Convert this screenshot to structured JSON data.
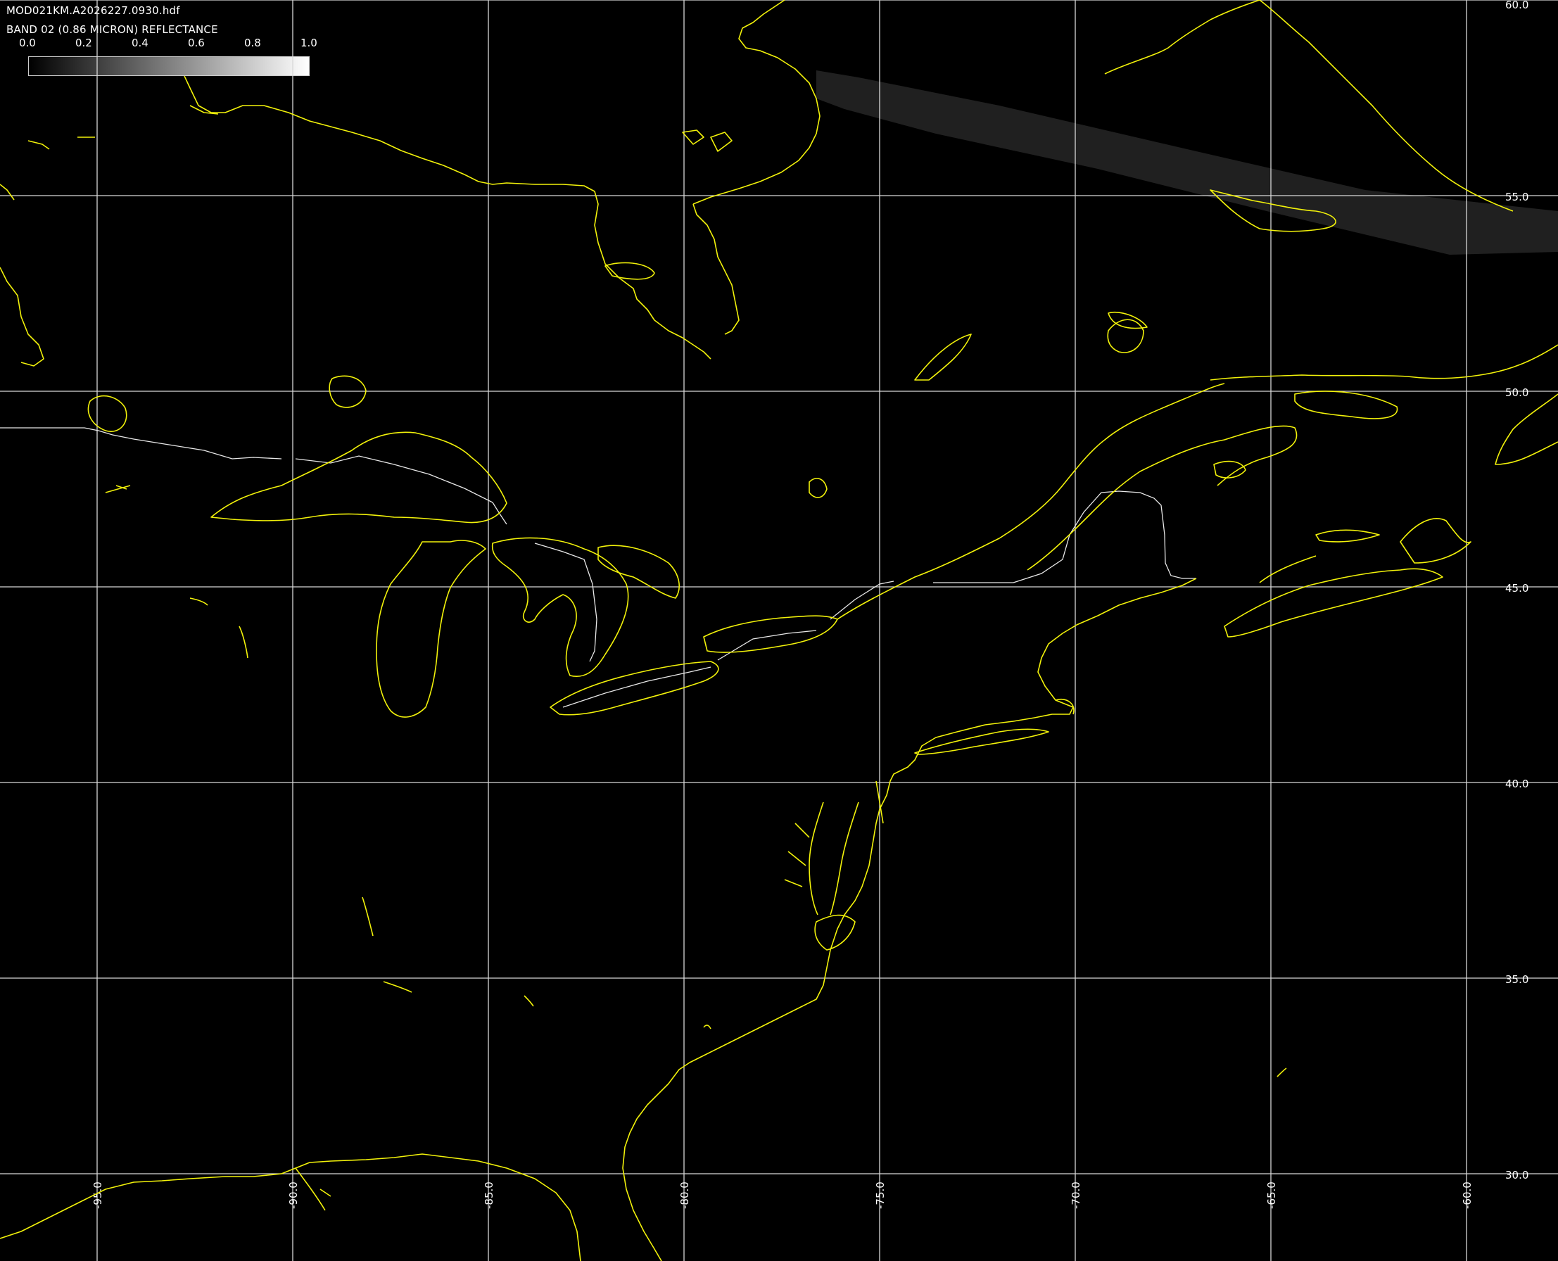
{
  "header": {
    "filename": "MOD021KM.A2026227.0930.hdf",
    "band_label": "BAND 02 (0.86 MICRON) REFLECTANCE"
  },
  "colorbar": {
    "ticks": [
      "0.0",
      "0.2",
      "0.4",
      "0.6",
      "0.8",
      "1.0"
    ],
    "range": [
      0.0,
      1.0
    ],
    "colors": {
      "low": "#000000",
      "high": "#ffffff"
    }
  },
  "map": {
    "background": "#000000",
    "coastline_color": "#f2f20a",
    "border_color": "#e8e8e8",
    "grid_color": "#d8d8d8",
    "lat_range": [
      28.0,
      60.0
    ],
    "lon_range": [
      -97.5,
      -57.5
    ],
    "latitudes": [
      {
        "value": 60,
        "label": "60.0"
      },
      {
        "value": 55,
        "label": "55.0"
      },
      {
        "value": 50,
        "label": "50.0"
      },
      {
        "value": 45,
        "label": "45.0"
      },
      {
        "value": 40,
        "label": "40.0"
      },
      {
        "value": 35,
        "label": "35.0"
      },
      {
        "value": 30,
        "label": "30.0"
      }
    ],
    "longitudes": [
      {
        "value": -95,
        "label": "-95.0"
      },
      {
        "value": -90,
        "label": "-90.0"
      },
      {
        "value": -85,
        "label": "-85.0"
      },
      {
        "value": -80,
        "label": "-80.0"
      },
      {
        "value": -75,
        "label": "-75.0"
      },
      {
        "value": -70,
        "label": "-70.0"
      },
      {
        "value": -65,
        "label": "-65.0"
      },
      {
        "value": -60,
        "label": "-60.0"
      }
    ],
    "swath": "faint gray satellite swath strip in upper right (Labrador region)"
  }
}
